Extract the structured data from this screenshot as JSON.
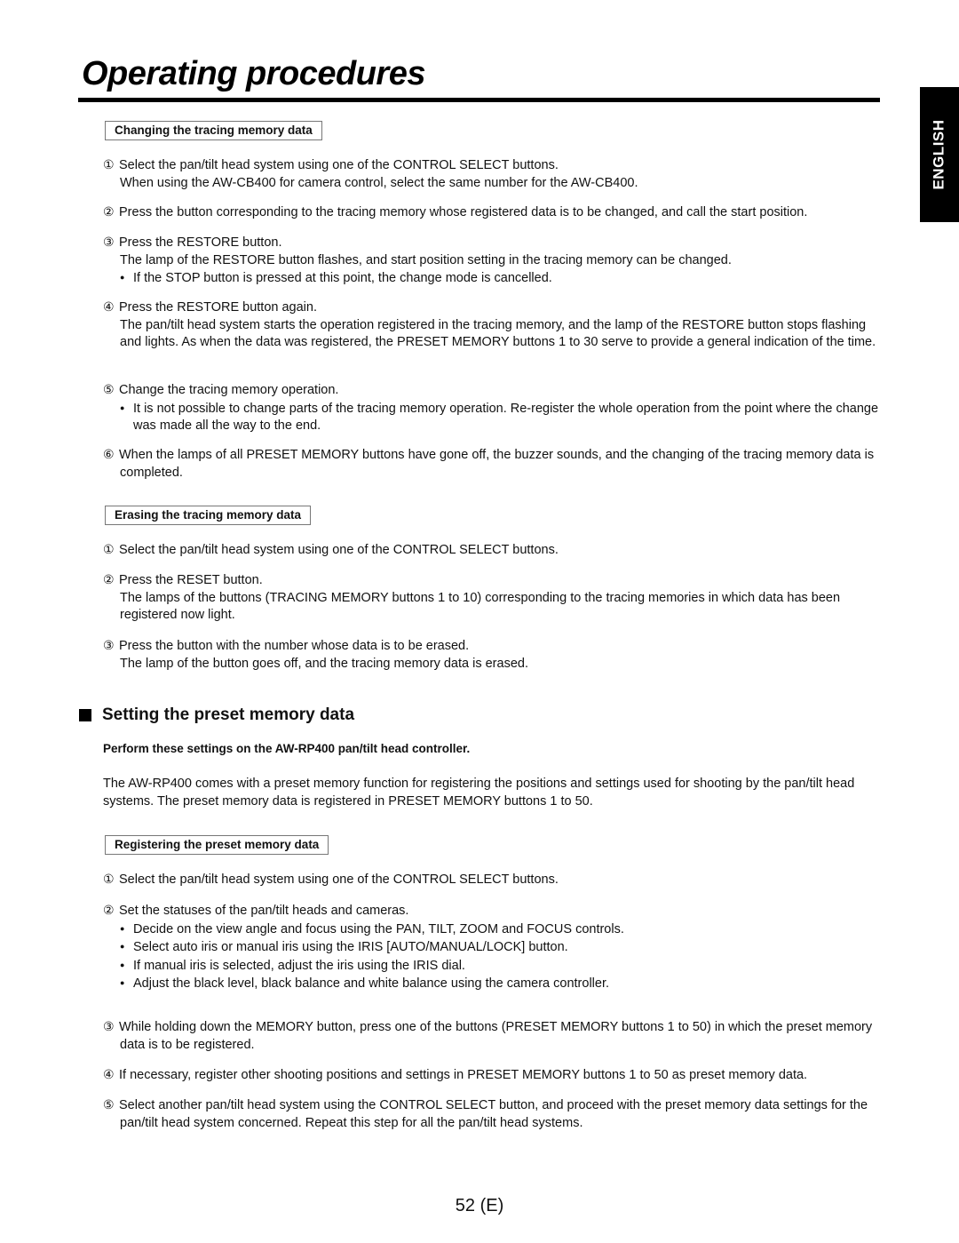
{
  "page": {
    "title": "Operating procedures",
    "language_tab": "ENGLISH",
    "page_number": "52 (E)"
  },
  "changing": {
    "heading": "Changing the tracing memory data",
    "steps": [
      {
        "num": "①",
        "text": "Select the pan/tilt head system using one of the CONTROL SELECT buttons.",
        "cont": "When using the AW-CB400 for camera control, select the same number for the AW-CB400."
      },
      {
        "num": "②",
        "text": "Press the button corresponding to the tracing memory whose registered data is to be changed, and call the start position."
      },
      {
        "num": "③",
        "text": "Press the RESTORE button.",
        "cont": "The lamp of the RESTORE button flashes, and start position setting in the tracing memory can be changed.",
        "bullets": [
          "If the STOP button is pressed at this point, the change mode is cancelled."
        ]
      },
      {
        "num": "④",
        "text": "Press the RESTORE button again.",
        "cont": "The pan/tilt head system starts the operation registered in the tracing memory, and the lamp of the RESTORE button stops flashing and lights. As when the data was registered, the PRESET MEMORY buttons 1 to 30 serve to provide a general indication of the time."
      },
      {
        "num": "⑤",
        "text": "Change the tracing memory operation.",
        "bullets": [
          "It is not possible to change parts of the tracing memory operation. Re-register the whole operation from the point where the change was made all the way to the end."
        ]
      },
      {
        "num": "⑥",
        "text": "When the lamps of all PRESET MEMORY buttons have gone off, the buzzer sounds, and the changing of the tracing memory data is completed."
      }
    ]
  },
  "erasing": {
    "heading": "Erasing the tracing memory data",
    "steps": [
      {
        "num": "①",
        "text": "Select the pan/tilt head system using one of the CONTROL SELECT buttons."
      },
      {
        "num": "②",
        "text": "Press the RESET button.",
        "cont": "The lamps of the buttons (TRACING MEMORY buttons 1 to 10) corresponding to the tracing memories in which data has been registered now light."
      },
      {
        "num": "③",
        "text": "Press the button with the number whose data is to be erased.",
        "cont": "The lamp of the button goes off, and the tracing memory data is erased."
      }
    ]
  },
  "preset": {
    "heading": "Setting the preset memory data",
    "note": "Perform these settings on the AW-RP400 pan/tilt head controller.",
    "intro": "The AW-RP400 comes with a preset memory function for registering the positions and settings used for shooting by the pan/tilt head systems. The preset memory data is registered in PRESET MEMORY buttons 1 to 50.",
    "registering": {
      "heading": "Registering the preset memory data",
      "steps": [
        {
          "num": "①",
          "text": "Select the pan/tilt head system using one of the CONTROL SELECT buttons."
        },
        {
          "num": "②",
          "text": "Set the statuses of the pan/tilt heads and cameras.",
          "bullets": [
            "Decide on the view angle and focus using the PAN, TILT, ZOOM and FOCUS controls.",
            "Select auto iris or manual iris using the IRIS [AUTO/MANUAL/LOCK] button.",
            "If manual iris is selected, adjust the iris using the IRIS dial.",
            "Adjust the black level, black balance and white balance using the camera controller."
          ]
        },
        {
          "num": "③",
          "text": "While holding down the MEMORY button, press one of the buttons (PRESET MEMORY buttons 1 to 50) in which the preset memory data is to be registered."
        },
        {
          "num": "④",
          "text": "If necessary, register other shooting positions and settings in PRESET MEMORY buttons 1 to 50 as preset memory data."
        },
        {
          "num": "⑤",
          "text": "Select another pan/tilt head system using the CONTROL SELECT button, and proceed with the preset memory data settings for the pan/tilt head system concerned. Repeat this step for all the pan/tilt head systems."
        }
      ]
    }
  }
}
